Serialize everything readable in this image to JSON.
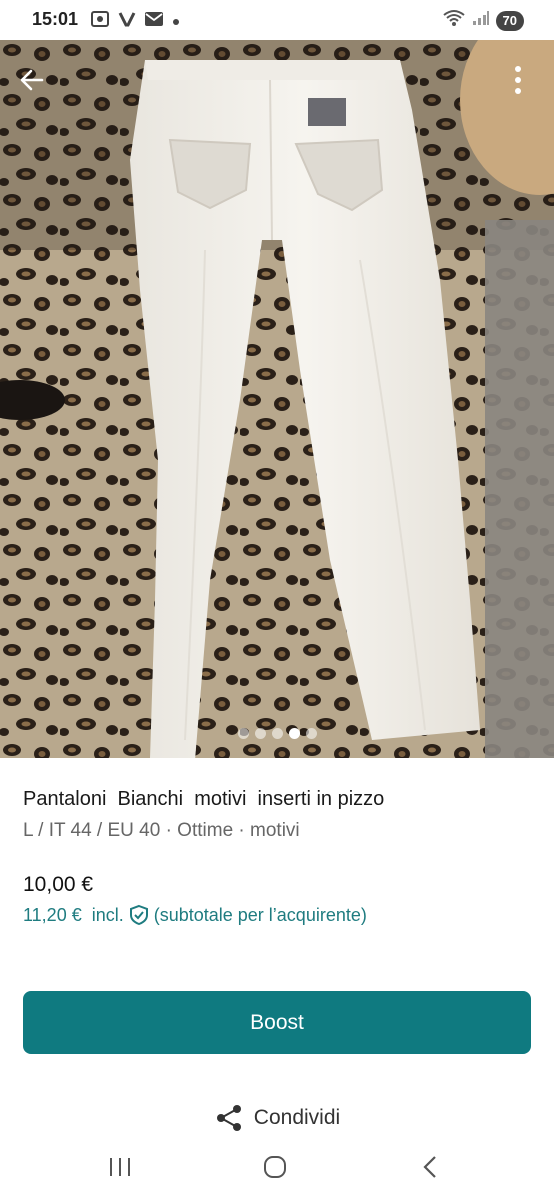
{
  "status_bar": {
    "time": "15:01",
    "left_icons": [
      "screen-recorder-icon",
      "v-app-icon",
      "mail-icon",
      "notification-dot-icon"
    ],
    "right_icons": [
      "wifi-icon",
      "signal-icon"
    ],
    "battery": "70"
  },
  "gallery": {
    "image_description_icon": "white-pants-photo",
    "total_images": 5,
    "active_index": 3
  },
  "item": {
    "title": "Pantaloni  Bianchi  motivi  inserti in pizzo",
    "details": "L / IT 44 / EU 40 · Ottime · motivi",
    "price": "10,00 €",
    "price_incl_amount": "11,20 €  incl.",
    "price_incl_note": "(subtotale per l’acquirente)"
  },
  "actions": {
    "boost_label": "Boost",
    "share_label": "Condividi"
  },
  "colors": {
    "accent": "#0f7a80",
    "accent_text": "#1f7c80"
  }
}
